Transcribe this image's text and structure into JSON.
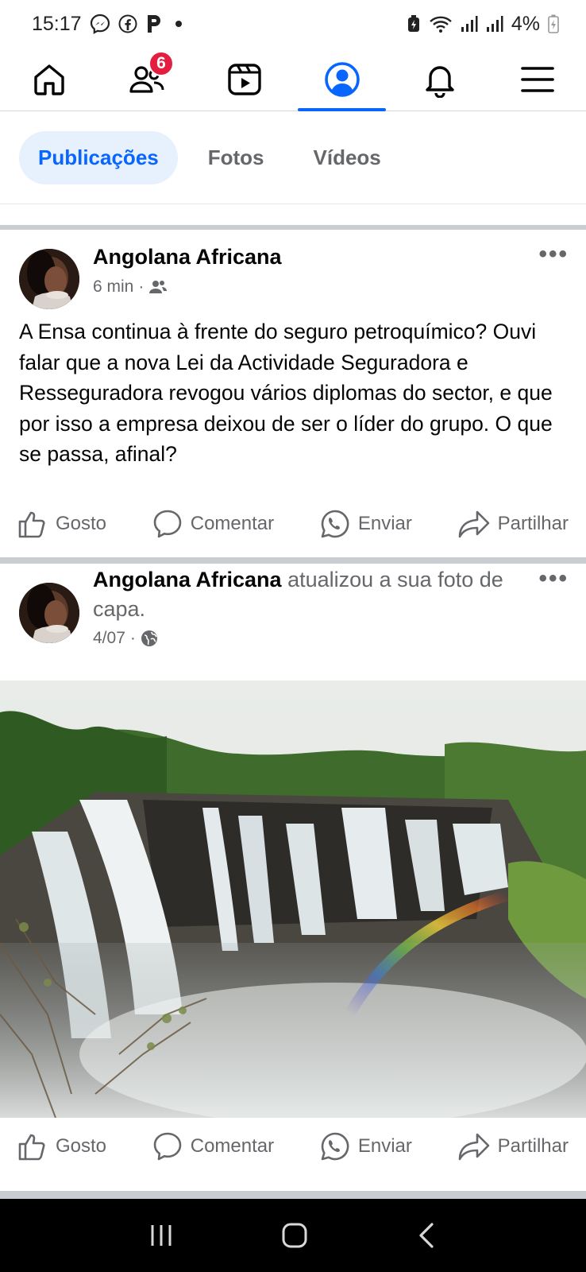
{
  "status_bar": {
    "time": "15:17",
    "battery_percent": "4%",
    "icons": [
      "messenger-icon",
      "facebook-icon",
      "p-app-icon",
      "dot-icon",
      "battery-saver-icon",
      "wifi-icon",
      "signal-icon",
      "signal-icon",
      "battery-icon"
    ]
  },
  "top_nav": {
    "items": [
      {
        "icon": "home-icon",
        "active": false
      },
      {
        "icon": "friends-icon",
        "active": false,
        "badge": "6"
      },
      {
        "icon": "video-icon",
        "active": false
      },
      {
        "icon": "profile-icon",
        "active": true
      },
      {
        "icon": "bell-icon",
        "active": false
      },
      {
        "icon": "menu-icon",
        "active": false
      }
    ],
    "accent": "#0866ff",
    "badge_color": "#e41e3f"
  },
  "tabs": [
    {
      "label": "Publicações",
      "active": true
    },
    {
      "label": "Fotos",
      "active": false
    },
    {
      "label": "Vídeos",
      "active": false
    }
  ],
  "posts": [
    {
      "author": "Angolana Africana",
      "action": "",
      "time": "6 min",
      "audience_icon": "friends-audience-icon",
      "text": "A Ensa continua à frente do seguro petroquímico? Ouvi falar que a nova Lei da Actividade Seguradora e Resseguradora revogou vários diplomas do sector, e que por isso a empresa deixou de ser o líder do grupo. O que se passa, afinal?",
      "more": "•••"
    },
    {
      "author": "Angolana Africana",
      "action": "atualizou a sua foto de capa.",
      "time": "4/07",
      "audience_icon": "globe-icon",
      "more": "•••"
    }
  ],
  "post_actions": {
    "like": "Gosto",
    "comment": "Comentar",
    "send": "Enviar",
    "share": "Partilhar"
  },
  "system_nav": [
    "recents-icon",
    "home-button-icon",
    "back-icon"
  ]
}
